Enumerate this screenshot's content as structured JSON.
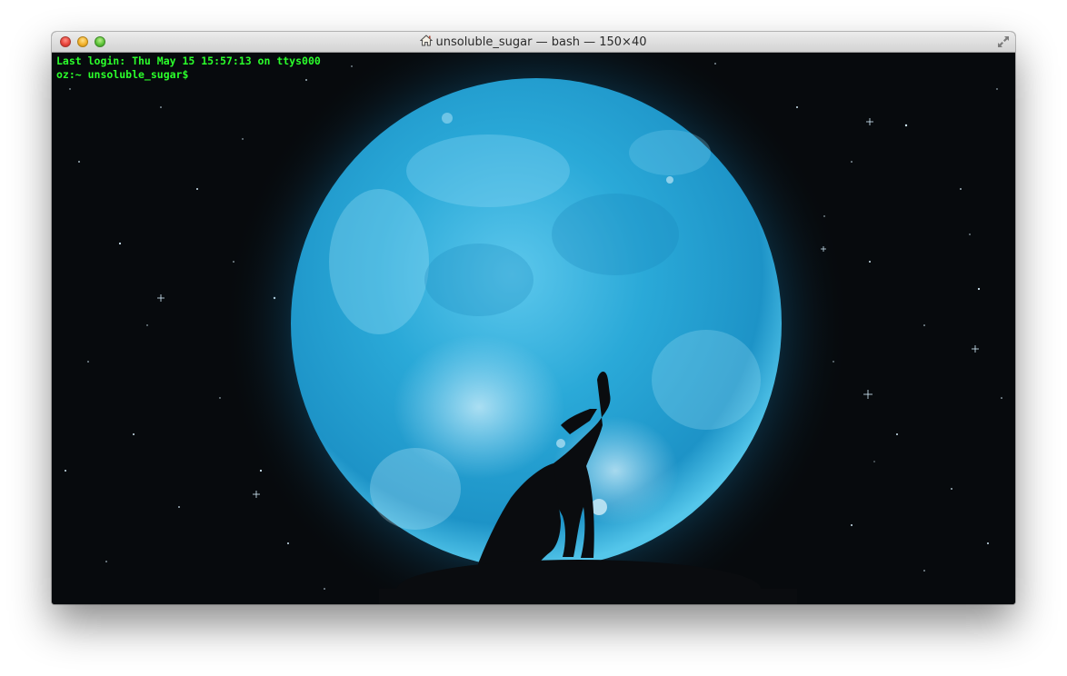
{
  "window": {
    "title": "unsoluble_sugar — bash — 150×40",
    "title_icon": "home-icon",
    "buttons": [
      "close",
      "minimize",
      "zoom"
    ],
    "fullscreen_icon": "fullscreen-arrows-icon"
  },
  "terminal": {
    "lines": [
      "Last login: Thu May 15 15:57:13 on ttys000",
      "oz:~ unsoluble_sugar$"
    ],
    "text_color": "#2bff2b"
  },
  "background": {
    "description_icon": "wallpaper-moon-wolf",
    "moon_color": "#2aa9d8",
    "sky_color": "#070a0d"
  }
}
